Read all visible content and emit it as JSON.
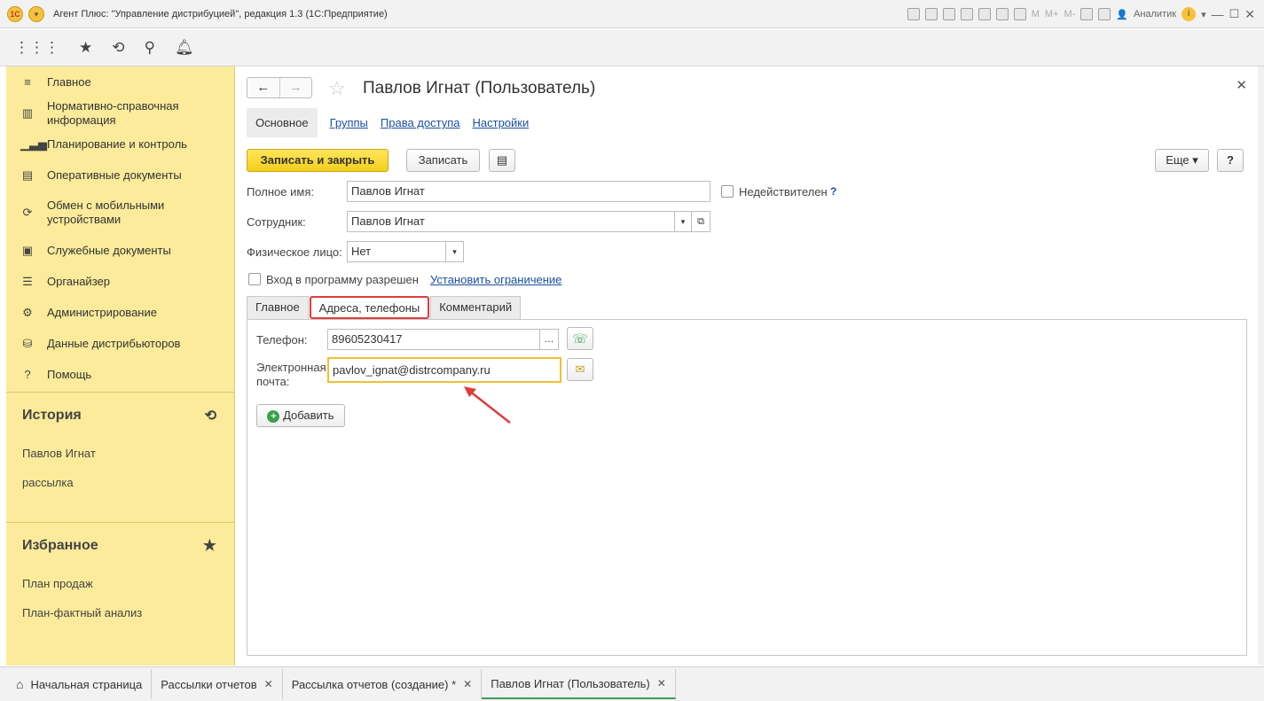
{
  "window": {
    "title": "Агент Плюс: \"Управление дистрибуцией\", редакция 1.3  (1С:Предприятие)",
    "user": "Аналитик",
    "mem_buttons": [
      "M",
      "M+",
      "M-"
    ]
  },
  "sidebar": {
    "items": [
      {
        "label": "Главное",
        "icon": "menu-icon"
      },
      {
        "label": "Нормативно-справочная информация",
        "icon": "reference-icon"
      },
      {
        "label": "Планирование и контроль",
        "icon": "chart-icon"
      },
      {
        "label": "Оперативные документы",
        "icon": "documents-icon"
      },
      {
        "label": "Обмен с мобильными устройствами",
        "icon": "sync-icon"
      },
      {
        "label": "Служебные документы",
        "icon": "service-docs-icon"
      },
      {
        "label": "Органайзер",
        "icon": "organizer-icon"
      },
      {
        "label": "Администрирование",
        "icon": "gear-icon"
      },
      {
        "label": "Данные дистрибьюторов",
        "icon": "distributors-icon"
      },
      {
        "label": "Помощь",
        "icon": "help-icon"
      }
    ],
    "history": {
      "title": "История",
      "links": [
        "Павлов Игнат",
        "рассылка"
      ]
    },
    "favorites": {
      "title": "Избранное",
      "links": [
        "План продаж",
        "План-фактный анализ"
      ]
    }
  },
  "form": {
    "title": "Павлов Игнат (Пользователь)",
    "tabs": {
      "active": "Основное",
      "links": [
        "Группы",
        "Права доступа",
        "Настройки"
      ]
    },
    "buttons": {
      "save_close": "Записать и закрыть",
      "save": "Записать",
      "more": "Еще",
      "help": "?"
    },
    "fields": {
      "full_name_label": "Полное имя:",
      "full_name_value": "Павлов Игнат",
      "invalid_label": "Недействителен",
      "invalid_help": "?",
      "employee_label": "Сотрудник:",
      "employee_value": "Павлов Игнат",
      "person_label": "Физическое лицо:",
      "person_value": "Нет",
      "login_label": "Вход в программу разрешен",
      "set_limit_link": "Установить ограничение"
    },
    "inner_tabs": [
      "Главное",
      "Адреса, телефоны",
      "Комментарий"
    ],
    "inner_active": 1,
    "contacts": {
      "phone_label": "Телефон:",
      "phone_value": "89605230417",
      "email_label": "Электронная почта:",
      "email_value": "pavlov_ignat@distrcompany.ru",
      "add_button": "Добавить"
    }
  },
  "taskbar": {
    "home": "Начальная страница",
    "tabs": [
      "Рассылки отчетов",
      "Рассылка отчетов (создание) *",
      "Павлов Игнат (Пользователь)"
    ]
  },
  "colors": {
    "accent_yellow": "#f4cf1c",
    "sidebar": "#fbeb9b",
    "highlight_red": "#e03c3c",
    "link": "#1a4fa0"
  }
}
